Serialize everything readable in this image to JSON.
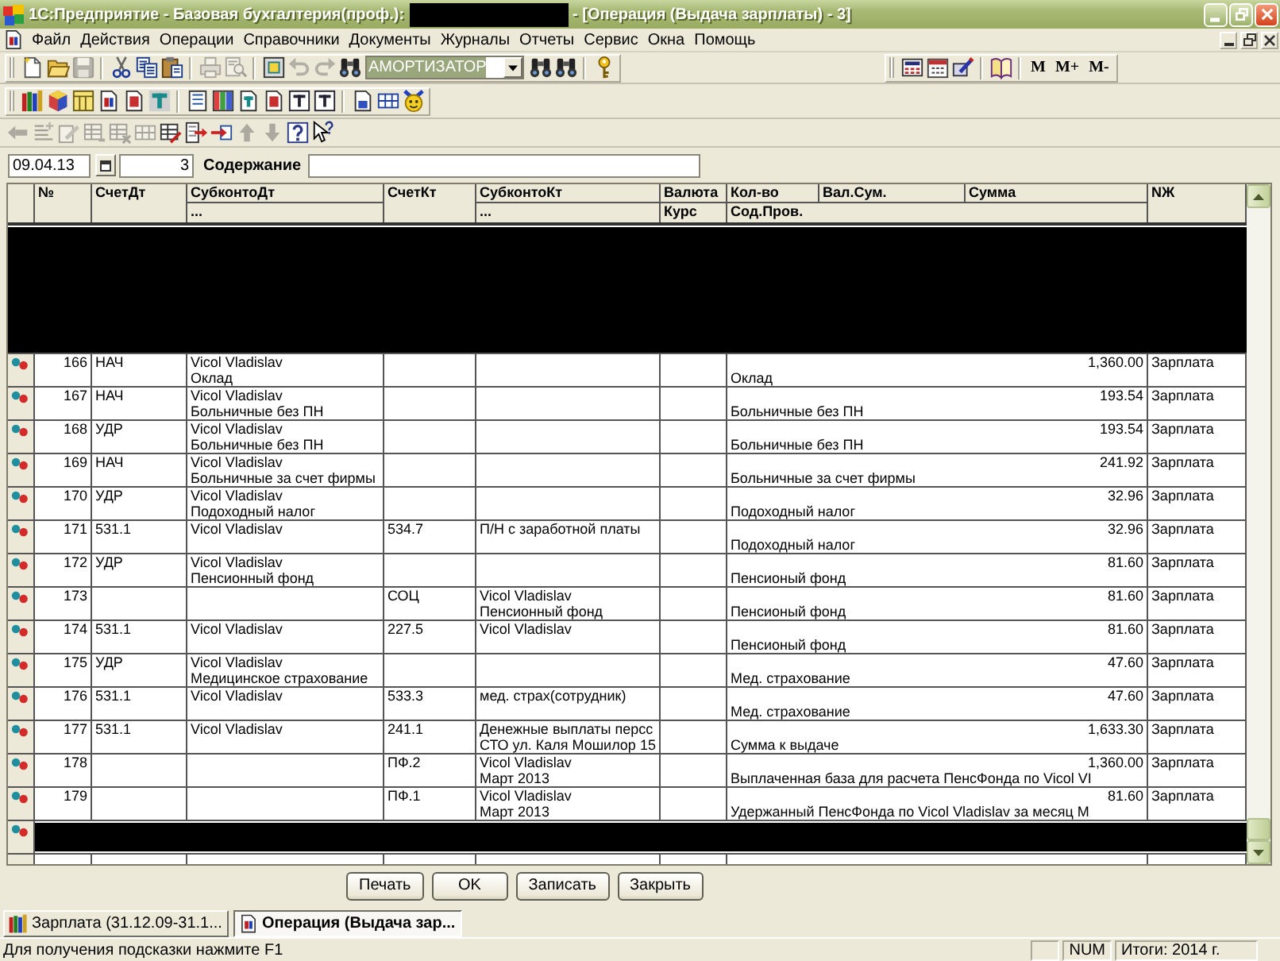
{
  "window": {
    "title": "1С:Предприятие - Базовая бухгалтерия(проф.):",
    "title_redacted": true,
    "document_title": "- [Операция (Выдача зарплаты) - 3]"
  },
  "menu": [
    "Файл",
    "Действия",
    "Операции",
    "Справочники",
    "Документы",
    "Журналы",
    "Отчеты",
    "Сервис",
    "Окна",
    "Помощь"
  ],
  "toolbars": [
    {
      "groups": [
        {
          "items": [
            {
              "kind": "button",
              "disabled": false
            },
            {
              "kind": "button",
              "disabled": false
            },
            {
              "kind": "button",
              "disabled": true
            }
          ]
        },
        {
          "items": [
            {
              "kind": "button",
              "disabled": false
            },
            {
              "kind": "button",
              "disabled": false
            },
            {
              "kind": "button",
              "disabled": false
            }
          ]
        },
        {
          "items": [
            {
              "kind": "button",
              "disabled": true
            },
            {
              "kind": "button",
              "disabled": true
            }
          ]
        },
        {
          "items": [
            {
              "kind": "button",
              "disabled": false
            },
            {
              "kind": "button",
              "disabled": true
            },
            {
              "kind": "button",
              "disabled": true
            },
            {
              "kind": "button",
              "disabled": false
            },
            {
              "kind": "combo",
              "value": "АМОРТИЗАТОР",
              "text_selected": true
            },
            {
              "kind": "button",
              "disabled": false
            },
            {
              "kind": "button",
              "disabled": false
            }
          ]
        },
        {
          "items": [
            {
              "kind": "button",
              "disabled": false
            }
          ]
        }
      ]
    },
    {
      "groups": [
        {
          "items": [
            {
              "kind": "button",
              "disabled": false
            },
            {
              "kind": "button",
              "disabled": false
            },
            {
              "kind": "button",
              "disabled": false
            }
          ]
        },
        {
          "items": [
            {
              "kind": "button",
              "disabled": false
            }
          ]
        },
        {
          "items": [
            {
              "kind": "text",
              "label": "M"
            },
            {
              "kind": "text",
              "label": "M+"
            },
            {
              "kind": "text",
              "label": "M-"
            }
          ]
        }
      ]
    },
    {
      "groups": [
        {
          "items": [
            {
              "kind": "button",
              "disabled": false
            },
            {
              "kind": "button",
              "disabled": false
            },
            {
              "kind": "button",
              "disabled": false
            },
            {
              "kind": "button",
              "disabled": false
            },
            {
              "kind": "button",
              "disabled": false
            },
            {
              "kind": "button",
              "disabled": false
            }
          ]
        },
        {
          "items": [
            {
              "kind": "button",
              "disabled": false
            },
            {
              "kind": "button",
              "disabled": false
            },
            {
              "kind": "button",
              "disabled": false
            },
            {
              "kind": "button",
              "disabled": false
            },
            {
              "kind": "button",
              "disabled": false
            },
            {
              "kind": "button",
              "disabled": false
            }
          ]
        },
        {
          "items": [
            {
              "kind": "button",
              "disabled": false
            },
            {
              "kind": "button",
              "disabled": false
            },
            {
              "kind": "button",
              "disabled": false
            }
          ]
        }
      ]
    },
    {
      "groups": [
        {
          "items": [
            {
              "kind": "button",
              "disabled": true
            },
            {
              "kind": "button",
              "disabled": true
            },
            {
              "kind": "button",
              "disabled": true
            },
            {
              "kind": "button",
              "disabled": true
            },
            {
              "kind": "button",
              "disabled": true
            },
            {
              "kind": "button",
              "disabled": true
            },
            {
              "kind": "button",
              "disabled": false
            },
            {
              "kind": "button",
              "disabled": false
            },
            {
              "kind": "button",
              "disabled": false
            },
            {
              "kind": "button",
              "disabled": true
            },
            {
              "kind": "button",
              "disabled": true
            },
            {
              "kind": "button",
              "disabled": false
            },
            {
              "kind": "button",
              "disabled": false
            }
          ]
        }
      ]
    }
  ],
  "form": {
    "date": "09.04.13",
    "number": "3",
    "content_label": "Содержание"
  },
  "table": {
    "columns": {
      "number": "№",
      "debit_account": "СчетДт",
      "debit_subconto": "СубконтоДт",
      "debit_subconto_2": "...",
      "credit_account": "СчетКт",
      "credit_subconto": "СубконтоКт",
      "credit_subconto_2": "...",
      "currency": "Валюта",
      "rate": "Курс",
      "quantity": "Кол-во",
      "currency_sum": "Вал.Сум.",
      "sum": "Сумма",
      "entry_content": "Сод.Пров.",
      "journal": "NЖ"
    },
    "rows": [
      {
        "kind": "hidden_block"
      },
      {
        "kind": "entry",
        "number": "166",
        "debit_account": "НАЧ",
        "debit_subconto": [
          "Vicol Vladislav",
          "Оклад"
        ],
        "sum": "1,360.00",
        "content": "Оклад",
        "journal": "Зарплата"
      },
      {
        "kind": "entry",
        "number": "167",
        "debit_account": "НАЧ",
        "debit_subconto": [
          "Vicol Vladislav",
          "Больничные без ПН"
        ],
        "sum": "193.54",
        "content": "Больничные без ПН",
        "journal": "Зарплата"
      },
      {
        "kind": "entry",
        "number": "168",
        "debit_account": "УДР",
        "debit_subconto": [
          "Vicol Vladislav",
          "Больничные без ПН"
        ],
        "sum": "193.54",
        "content": "Больничные без ПН",
        "journal": "Зарплата"
      },
      {
        "kind": "entry",
        "number": "169",
        "debit_account": "НАЧ",
        "debit_subconto": [
          "Vicol Vladislav",
          "Больничные за счет фирмы"
        ],
        "sum": "241.92",
        "content": "Больничные за счет фирмы",
        "journal": "Зарплата"
      },
      {
        "kind": "entry",
        "number": "170",
        "debit_account": "УДР",
        "debit_subconto": [
          "Vicol Vladislav",
          "Подоходный налог"
        ],
        "sum": "32.96",
        "content": "Подоходный налог",
        "journal": "Зарплата"
      },
      {
        "kind": "entry",
        "number": "171",
        "debit_account": "531.1",
        "debit_subconto": [
          "Vicol Vladislav"
        ],
        "credit_account": "534.7",
        "credit_subconto": [
          "П/Н с заработной платы"
        ],
        "sum": "32.96",
        "content": "Подоходный налог",
        "journal": "Зарплата"
      },
      {
        "kind": "entry",
        "number": "172",
        "debit_account": "УДР",
        "debit_subconto": [
          "Vicol Vladislav",
          "Пенсионный фонд"
        ],
        "sum": "81.60",
        "content": "Пенсионый фонд",
        "journal": "Зарплата"
      },
      {
        "kind": "entry",
        "number": "173",
        "credit_account": "СОЦ",
        "credit_subconto": [
          "Vicol Vladislav",
          "Пенсионный фонд"
        ],
        "sum": "81.60",
        "content": "Пенсионый фонд",
        "journal": "Зарплата"
      },
      {
        "kind": "entry",
        "number": "174",
        "debit_account": "531.1",
        "debit_subconto": [
          "Vicol Vladislav"
        ],
        "credit_account": "227.5",
        "credit_subconto": [
          "Vicol Vladislav"
        ],
        "sum": "81.60",
        "content": "Пенсионый фонд",
        "journal": "Зарплата"
      },
      {
        "kind": "entry",
        "number": "175",
        "debit_account": "УДР",
        "debit_subconto": [
          "Vicol Vladislav",
          "Медицинское страхование"
        ],
        "sum": "47.60",
        "content": "Мед. страхование",
        "journal": "Зарплата"
      },
      {
        "kind": "entry",
        "number": "176",
        "debit_account": "531.1",
        "debit_subconto": [
          "Vicol Vladislav"
        ],
        "credit_account": "533.3",
        "credit_subconto": [
          "мед. страх(сотрудник)"
        ],
        "sum": "47.60",
        "content": "Мед. страхование",
        "journal": "Зарплата"
      },
      {
        "kind": "entry",
        "number": "177",
        "debit_account": "531.1",
        "debit_subconto": [
          "Vicol Vladislav"
        ],
        "credit_account": "241.1",
        "credit_subconto": [
          "Денежные выплаты персс",
          "СТО ул. Каля Мошилор 15"
        ],
        "sum": "1,633.30",
        "content": "Сумма к выдаче",
        "journal": "Зарплата"
      },
      {
        "kind": "entry",
        "number": "178",
        "credit_account": "ПФ.2",
        "credit_subconto": [
          "Vicol Vladislav",
          "Март 2013"
        ],
        "sum": "1,360.00",
        "content": "Выплаченная база для расчета ПенсФонда по Vicol VI",
        "journal": "Зарплата"
      },
      {
        "kind": "entry",
        "number": "179",
        "credit_account": "ПФ.1",
        "credit_subconto": [
          "Vicol Vladislav",
          "Март 2013"
        ],
        "sum": "81.60",
        "content": "Удержанный ПенсФонда по Vicol Vladislav за месяц М",
        "journal": "Зарплата"
      },
      {
        "kind": "hidden_row"
      }
    ]
  },
  "buttons": [
    "Печать",
    "OK",
    "Записать",
    "Закрыть"
  ],
  "window_tabs": [
    {
      "kind": "journal",
      "label": "Зарплата (31.12.09-31.1...",
      "selected": false
    },
    {
      "kind": "document",
      "label": "Операция (Выдача зар...",
      "selected": true
    }
  ],
  "status_bar": {
    "hint": "Для получения подсказки нажмите F1",
    "panels": [
      "NUM",
      "Итоги: 2014 г."
    ]
  }
}
